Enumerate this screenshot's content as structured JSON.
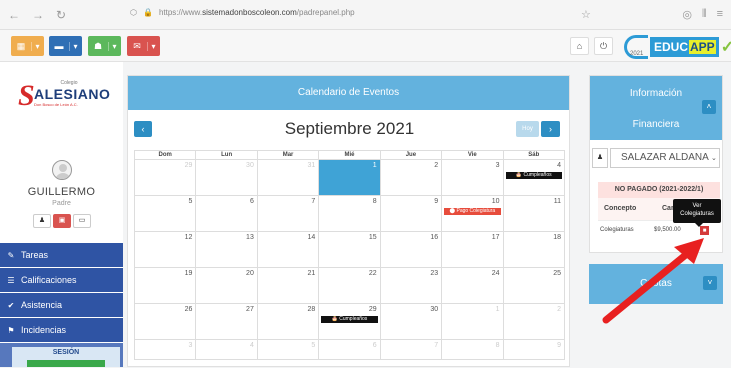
{
  "browser": {
    "nav_icons": [
      "back-icon",
      "forward-icon",
      "reload-icon"
    ],
    "url_prefix": "https://www.",
    "url_domain": "sistemadonboscoleon.com",
    "url_path": "/padrepanel.php"
  },
  "toolbar": {
    "buttons": [
      {
        "name": "calendar",
        "color": "#f0ad4e"
      },
      {
        "name": "card",
        "color": "#2f6fb5"
      },
      {
        "name": "user",
        "color": "#5cb85c"
      },
      {
        "name": "messages",
        "color": "#d9534f"
      }
    ]
  },
  "logo": {
    "year": "2021",
    "educ": "EDUC",
    "app": "APP"
  },
  "sidebar": {
    "school_small": "Colegio",
    "school_name": "ALESIANO",
    "school_sub": "Don Bosco de León A.C.",
    "user_name": "GUILLERMO",
    "user_role": "Padre",
    "menu": [
      {
        "label": "Tareas",
        "icon": "edit-icon",
        "glyph": "✎"
      },
      {
        "label": "Calificaciones",
        "icon": "list-icon",
        "glyph": "☰"
      },
      {
        "label": "Asistencia",
        "icon": "check-circle-icon",
        "glyph": "✔"
      },
      {
        "label": "Incidencias",
        "icon": "flag-icon",
        "glyph": "⚑"
      }
    ],
    "session_label": "SESIÓN"
  },
  "calendar": {
    "header": "Calendario de Eventos",
    "month_title": "Septiembre 2021",
    "today_label": "Hoy",
    "weekdays": [
      "Dom",
      "Lun",
      "Mar",
      "Mié",
      "Jue",
      "Vie",
      "Sáb"
    ],
    "weeks": [
      [
        {
          "d": "29",
          "o": true
        },
        {
          "d": "30",
          "o": true
        },
        {
          "d": "31",
          "o": true
        },
        {
          "d": "1",
          "today": true
        },
        {
          "d": "2"
        },
        {
          "d": "3"
        },
        {
          "d": "4",
          "ev": "🎂 Cumpleaños",
          "evc": "black"
        }
      ],
      [
        {
          "d": "5"
        },
        {
          "d": "6"
        },
        {
          "d": "7"
        },
        {
          "d": "8"
        },
        {
          "d": "9"
        },
        {
          "d": "10",
          "ev": "⬤ Pago Colegiatura",
          "evc": "red"
        },
        {
          "d": "11"
        }
      ],
      [
        {
          "d": "12"
        },
        {
          "d": "13"
        },
        {
          "d": "14"
        },
        {
          "d": "15"
        },
        {
          "d": "16"
        },
        {
          "d": "17"
        },
        {
          "d": "18"
        }
      ],
      [
        {
          "d": "19"
        },
        {
          "d": "20"
        },
        {
          "d": "21"
        },
        {
          "d": "22"
        },
        {
          "d": "23"
        },
        {
          "d": "24"
        },
        {
          "d": "25"
        }
      ],
      [
        {
          "d": "26"
        },
        {
          "d": "27"
        },
        {
          "d": "28"
        },
        {
          "d": "29",
          "ev": "🎂 Cumpleaños",
          "evc": "black"
        },
        {
          "d": "30"
        },
        {
          "d": "1",
          "o": true
        },
        {
          "d": "2",
          "o": true
        }
      ],
      [
        {
          "d": "3",
          "o": true
        },
        {
          "d": "4",
          "o": true
        },
        {
          "d": "5",
          "o": true
        },
        {
          "d": "6",
          "o": true
        },
        {
          "d": "7",
          "o": true
        },
        {
          "d": "8",
          "o": true
        },
        {
          "d": "9",
          "o": true
        }
      ]
    ]
  },
  "info": {
    "title_1": "Información",
    "title_2": "Financiera",
    "student_select": "SALAZAR ALDANA",
    "status": "NO PAGADO (2021-2022/1)",
    "col_concept": "Concepto",
    "col_amount": "Canti",
    "row_concept": "Colegiaturas",
    "row_amount": "$9,500.00",
    "tooltip_1": "Ver",
    "tooltip_2": "Colegiaturas",
    "cuotas_label": "Cuotas"
  }
}
